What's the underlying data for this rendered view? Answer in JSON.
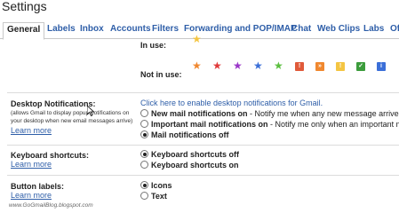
{
  "page_title": "Settings",
  "tabs": [
    "General",
    "Labels",
    "Inbox",
    "Accounts",
    "Filters",
    "Forwarding and POP/IMAP",
    "Chat",
    "Web Clips",
    "Labs",
    "Offline"
  ],
  "stars": {
    "in_use_label": "In use:",
    "not_in_use_label": "Not in use:",
    "in_use_icons": [
      {
        "name": "yellow-star",
        "color": "#f4c542"
      }
    ],
    "not_in_use_icons": [
      {
        "name": "orange-star",
        "color": "#f0882f"
      },
      {
        "name": "red-star",
        "color": "#e03a3a"
      },
      {
        "name": "purple-star",
        "color": "#9a36c9"
      },
      {
        "name": "blue-star",
        "color": "#3b6fd8"
      },
      {
        "name": "green-star",
        "color": "#5cbf40"
      },
      {
        "name": "red-bang",
        "glyph": "!",
        "color": "#e05a3a"
      },
      {
        "name": "orange-guillemet",
        "glyph": "»",
        "color": "#f0882f"
      },
      {
        "name": "yellow-bang",
        "glyph": "!",
        "color": "#f4c542"
      },
      {
        "name": "green-check",
        "glyph": "✓",
        "color": "#3c9c3c"
      },
      {
        "name": "blue-info",
        "glyph": "i",
        "color": "#3b6fd8"
      }
    ]
  },
  "desktop_notifications": {
    "title": "Desktop Notifications:",
    "description_line1": "(allows Gmail to display popup notifications on",
    "description_line2": "your desktop when new email messages arrive)",
    "learn_more": "Learn more",
    "enable_link": "Click here to enable desktop notifications for Gmail.",
    "option1_bold": "New mail notifications on",
    "option1_rest": " - Notify me when any new message arrives in",
    "option2_bold": "Important mail notifications on",
    "option2_rest": " - Notify me only when an important mes",
    "option3_bold": "Mail notifications off"
  },
  "keyboard_shortcuts": {
    "title": "Keyboard shortcuts:",
    "learn_more": "Learn more",
    "option_off": "Keyboard shortcuts off",
    "option_on": "Keyboard shortcuts on"
  },
  "button_labels": {
    "title": "Button labels:",
    "learn_more": "Learn more",
    "option_icons": "Icons",
    "option_text": "Text"
  },
  "watermark": "www.GoGmailBlog.blogspot.com",
  "colors": {
    "link": "#2e5ea8",
    "divider": "#dcdcdc"
  }
}
